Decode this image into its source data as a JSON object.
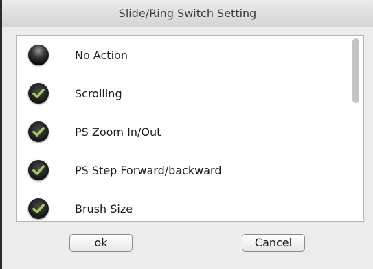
{
  "window": {
    "title": "Slide/Ring Switch Setting"
  },
  "list": {
    "items": [
      {
        "label": "No Action",
        "state": "off",
        "icon": "dot-icon"
      },
      {
        "label": "Scrolling",
        "state": "on",
        "icon": "check-icon"
      },
      {
        "label": "PS Zoom In/Out",
        "state": "on",
        "icon": "check-icon"
      },
      {
        "label": "PS Step Forward/backward",
        "state": "on",
        "icon": "check-icon"
      },
      {
        "label": "Brush Size",
        "state": "on",
        "icon": "check-icon"
      }
    ]
  },
  "buttons": {
    "ok_label": "ok",
    "cancel_label": "Cancel"
  },
  "colors": {
    "check": "#9fcf5a",
    "window_bg": "#ececec"
  }
}
